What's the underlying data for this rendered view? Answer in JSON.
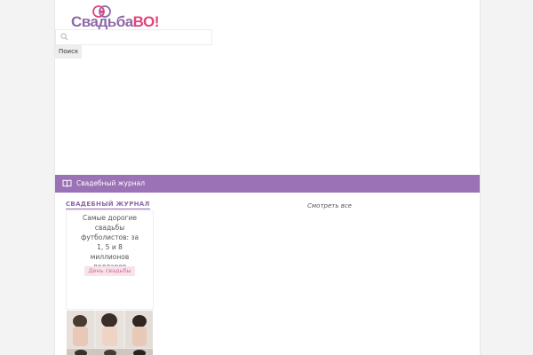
{
  "header": {
    "logo": {
      "text_part1": "Свадьба",
      "text_part2": "ВО!",
      "icon": "heart-rings-icon"
    }
  },
  "search": {
    "placeholder": "",
    "button_label": "Поиск",
    "icon": "search-icon"
  },
  "journal_bar": {
    "label": "Свадебный журнал",
    "icon": "book-icon",
    "color": "#9b72b5"
  },
  "journal_section": {
    "title": "СВАДЕБНЫЙ ЖУРНАЛ",
    "view_all": "Смотреть все",
    "articles": [
      {
        "title_lines": [
          "Самые дорогие",
          "свадьбы",
          "футболистов: за",
          "1, 5 и 8",
          "миллионов",
          "долларов"
        ],
        "tag": "День свадьбы"
      }
    ]
  },
  "colors": {
    "brand_purple": "#8e6aa8",
    "brand_pink": "#e0457c",
    "tag_bg": "#f7e3ec"
  }
}
